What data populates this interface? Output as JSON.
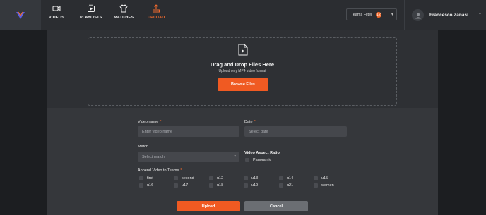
{
  "nav": {
    "items": [
      {
        "label": "VIDEOS",
        "icon": "video-camera-icon"
      },
      {
        "label": "PLAYLISTS",
        "icon": "playlist-icon"
      },
      {
        "label": "MATCHES",
        "icon": "jersey-icon"
      },
      {
        "label": "UPLOAD",
        "icon": "upload-icon",
        "active": true
      }
    ],
    "teams_filter": {
      "label": "Teams Filter",
      "count": "12"
    },
    "user_name": "Francesco Zanasi"
  },
  "dropzone": {
    "title": "Drag and Drop Files Here",
    "subtitle": "Upload only MP4 video format",
    "browse_label": "Browse Files"
  },
  "form": {
    "video_name_label": "Video name",
    "video_name_placeholder": "Enter video name",
    "date_label": "Date",
    "date_placeholder": "Select date",
    "match_label": "Match",
    "match_placeholder": "Select match",
    "aspect_title": "Video Aspect Ratio",
    "aspect_option": "Panoramic",
    "teams_label": "Append Video to Teams",
    "teams": [
      "first",
      "second",
      "u12",
      "u13",
      "u14",
      "u15",
      "u16",
      "u17",
      "u18",
      "u19",
      "u21",
      "women"
    ],
    "upload_label": "Upload",
    "cancel_label": "Cancel"
  },
  "colors": {
    "accent": "#f05a22",
    "background": "#2e3034"
  }
}
